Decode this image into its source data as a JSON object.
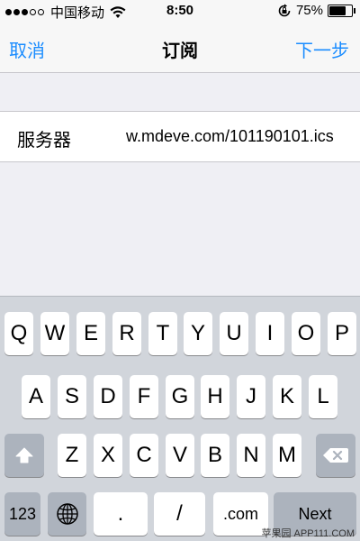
{
  "status_bar": {
    "carrier": "中国移动",
    "time": "8:50",
    "battery_percent": "75%",
    "battery_level": 0.75
  },
  "nav": {
    "cancel_label": "取消",
    "title": "订阅",
    "next_label": "下一步"
  },
  "form": {
    "server_label": "服务器",
    "server_value": "w.mdeve.com/101190101.ics"
  },
  "keyboard": {
    "row1": [
      "Q",
      "W",
      "E",
      "R",
      "T",
      "Y",
      "U",
      "I",
      "O",
      "P"
    ],
    "row2": [
      "A",
      "S",
      "D",
      "F",
      "G",
      "H",
      "J",
      "K",
      "L"
    ],
    "row3": [
      "Z",
      "X",
      "C",
      "V",
      "B",
      "N",
      "M"
    ],
    "numbers_label": "123",
    "dot_label": ".",
    "slash_label": "/",
    "dotcom_label": ".com",
    "next_label": "Next",
    "shift_icon": "shift-icon",
    "delete_icon": "delete-icon",
    "globe_icon": "globe-icon"
  },
  "watermark": "苹果园 APP111.COM",
  "colors": {
    "accent": "#1a8cff",
    "keyboard_bg": "#d1d5db",
    "dark_key": "#acb3bd"
  }
}
